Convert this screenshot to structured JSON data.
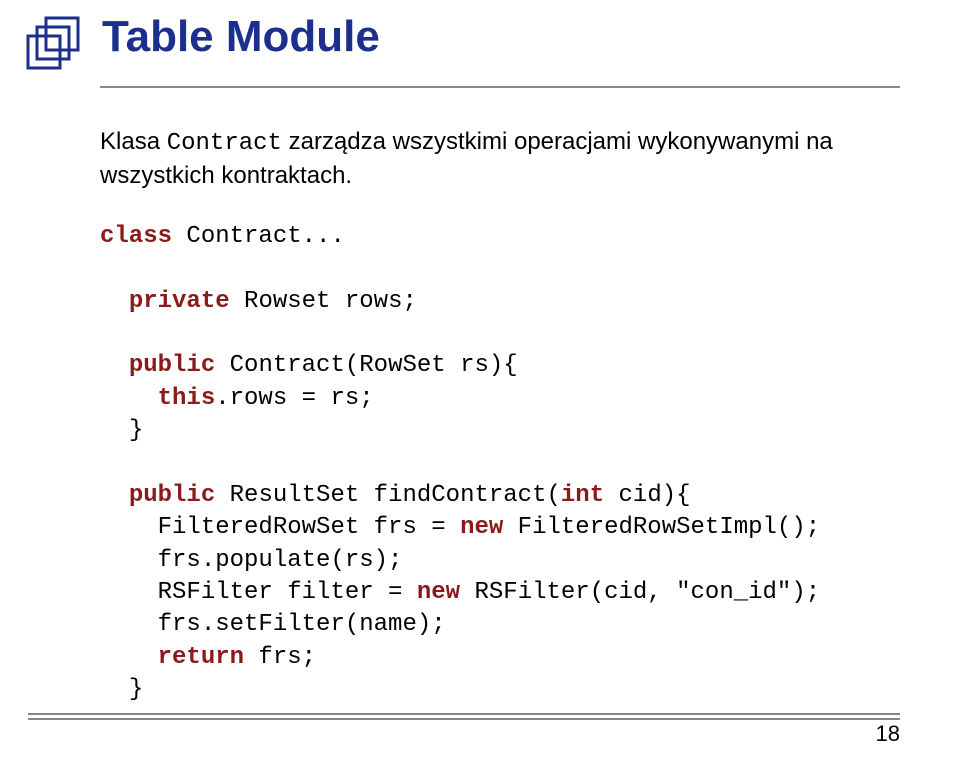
{
  "title": "Table Module",
  "description_prefix": "Klasa ",
  "description_mono": "Contract",
  "description_suffix": " zarządza wszystkimi operacjami wykonywanymi na wszystkich kontraktach.",
  "code": {
    "kw_class": "class",
    "class_name": " Contract...",
    "kw_private": "private",
    "private_rest": " Rowset rows;",
    "kw_public1": "public",
    "public1_rest": " Contract(RowSet rs){",
    "kw_this": "this",
    "this_rest": ".rows = rs;",
    "close1": "}",
    "kw_public2": "public",
    "public2_rest": " ResultSet findContract(",
    "kw_int": "int",
    "public2_rest2": " cid){",
    "line_frs1": "    FilteredRowSet frs = ",
    "kw_new1": "new",
    "line_frs1_rest": " FilteredRowSetImpl();",
    "line_populate": "    frs.populate(rs);",
    "line_filter1": "    RSFilter filter = ",
    "kw_new2": "new",
    "line_filter1_rest": " RSFilter(cid, \"con_id\");",
    "line_setfilter": "    frs.setFilter(name);",
    "indent_return": "    ",
    "kw_return": "return",
    "return_rest": " frs;",
    "close2": "}"
  },
  "page_number": "18"
}
